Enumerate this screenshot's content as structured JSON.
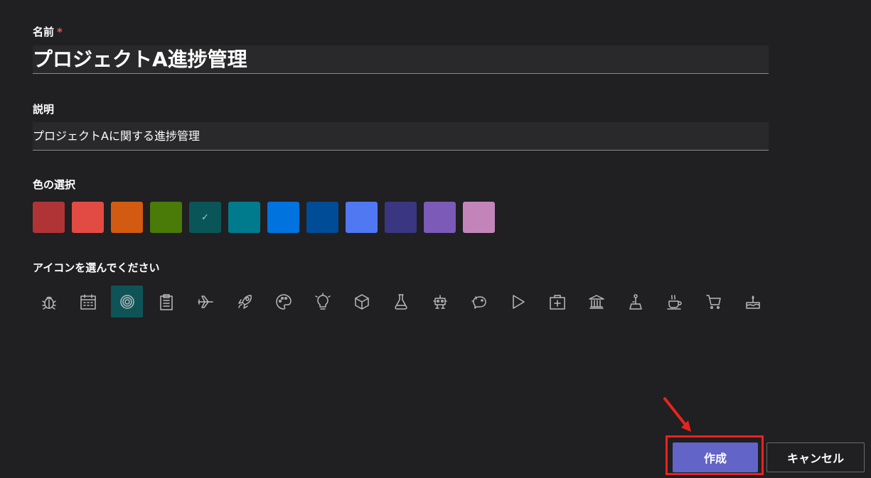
{
  "name": {
    "label": "名前",
    "required_mark": "*",
    "value": "プロジェクトA進捗管理"
  },
  "description": {
    "label": "説明",
    "value": "プロジェクトAに関する進捗管理"
  },
  "color_picker": {
    "label": "色の選択",
    "selected_index": 4,
    "colors": [
      "#b03435",
      "#e24b43",
      "#d35a11",
      "#4a7a08",
      "#0a5558",
      "#007a8d",
      "#0073df",
      "#004c96",
      "#5078f2",
      "#3b3681",
      "#7b5ab8",
      "#c385b9"
    ]
  },
  "icon_picker": {
    "label": "アイコンを選んでください",
    "selected_index": 2,
    "icons": [
      "bug-icon",
      "calendar-icon",
      "target-icon",
      "clipboard-icon",
      "airplane-icon",
      "rocket-icon",
      "palette-icon",
      "lightbulb-icon",
      "cube-icon",
      "flask-icon",
      "robot-icon",
      "piggy-bank-icon",
      "play-icon",
      "first-aid-icon",
      "bank-icon",
      "joystick-icon",
      "coffee-icon",
      "cart-icon",
      "cake-icon"
    ]
  },
  "actions": {
    "create_label": "作成",
    "cancel_label": "キャンセル",
    "accent": "#6264c7",
    "highlight_color": "#e8231d"
  }
}
